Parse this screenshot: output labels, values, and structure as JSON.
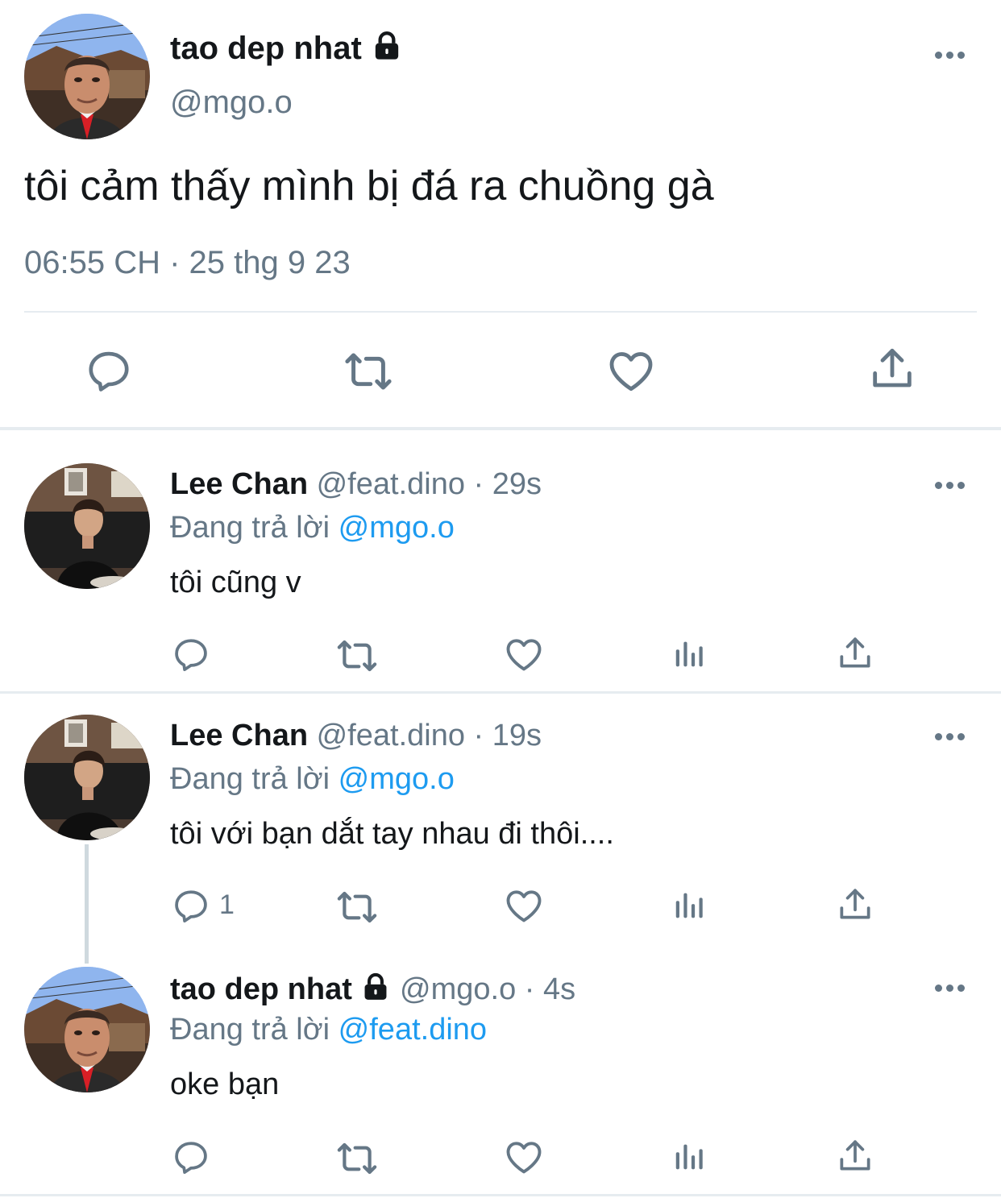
{
  "main_tweet": {
    "author_name": "tao dep nhat",
    "handle": "@mgo.o",
    "text": "tôi cảm thấy mình bị đá ra chuồng gà",
    "timestamp": "06:55 CH · 25 thg 9 23",
    "avatar": "mr-bean-avatar",
    "locked_icon": "lock-icon",
    "actions": [
      "reply-icon",
      "retweet-icon",
      "like-icon",
      "share-icon"
    ]
  },
  "replies": [
    {
      "author_name": "Lee Chan",
      "handle": "@feat.dino",
      "time": "· 29s",
      "replying_label": "Đang trả lời",
      "replying_to": "@mgo.o",
      "text": "tôi cũng v",
      "reply_count": "",
      "avatar": "lee-chan-avatar"
    },
    {
      "author_name": "Lee Chan",
      "handle": "@feat.dino",
      "time": "· 19s",
      "replying_label": "Đang trả lời",
      "replying_to": "@mgo.o",
      "text": "tôi với bạn dắt tay nhau đi thôi....",
      "reply_count": "1",
      "avatar": "lee-chan-avatar"
    },
    {
      "author_name": "tao dep nhat",
      "handle": "@mgo.o",
      "time": "· 4s",
      "replying_label": "Đang trả lời",
      "replying_to": "@feat.dino",
      "text": "oke bạn",
      "reply_count": "",
      "avatar": "mr-bean-avatar"
    }
  ],
  "colors": {
    "text": "#14171a",
    "secondary": "#657786",
    "link": "#1d9bf0",
    "divider": "#e6ecf0"
  }
}
